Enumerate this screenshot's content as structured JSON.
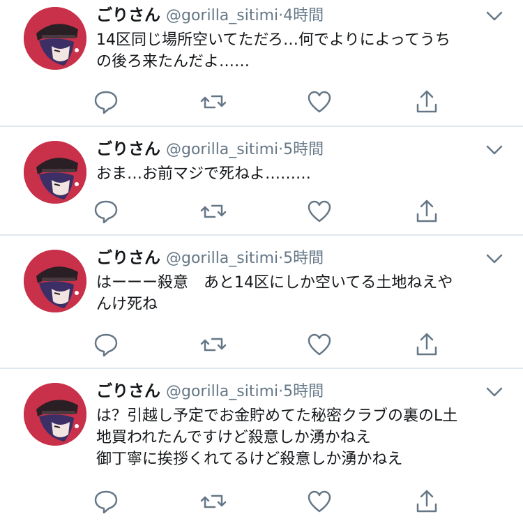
{
  "tweets": [
    {
      "name": "ごりさん",
      "handle": "@gorilla_sitimi",
      "separator": "·",
      "time": "4時間",
      "lines": [
        "14区同じ場所空いてただろ…何でよりによってうち",
        "の後ろ来たんだよ……"
      ]
    },
    {
      "name": "ごりさん",
      "handle": "@gorilla_sitimi",
      "separator": "·",
      "time": "5時間",
      "lines": [
        "おま…お前マジで死ねよ………"
      ]
    },
    {
      "name": "ごりさん",
      "handle": "@gorilla_sitimi",
      "separator": "·",
      "time": "5時間",
      "lines": [
        "はーーー殺意　あと14区にしか空いてる土地ねえや",
        "んけ死ね"
      ]
    },
    {
      "name": "ごりさん",
      "handle": "@gorilla_sitimi",
      "separator": "·",
      "time": "5時間",
      "lines": [
        "は？引越し予定でお金貯めてた秘密クラブの裏のL土",
        "地買われたんですけど殺意しか湧かねえ",
        "御丁寧に挨拶くれてるけど殺意しか湧かねえ"
      ]
    }
  ],
  "icons": {
    "reply": "reply-icon",
    "retweet": "retweet-icon",
    "like": "heart-icon",
    "share": "share-icon",
    "menu": "chevron-down-icon",
    "avatar": "avatar"
  },
  "colors": {
    "text": "#14171a",
    "secondary": "#657786",
    "icon": "#657786",
    "divider": "#e1e8ed",
    "avatar_bg": "#c9304a"
  }
}
